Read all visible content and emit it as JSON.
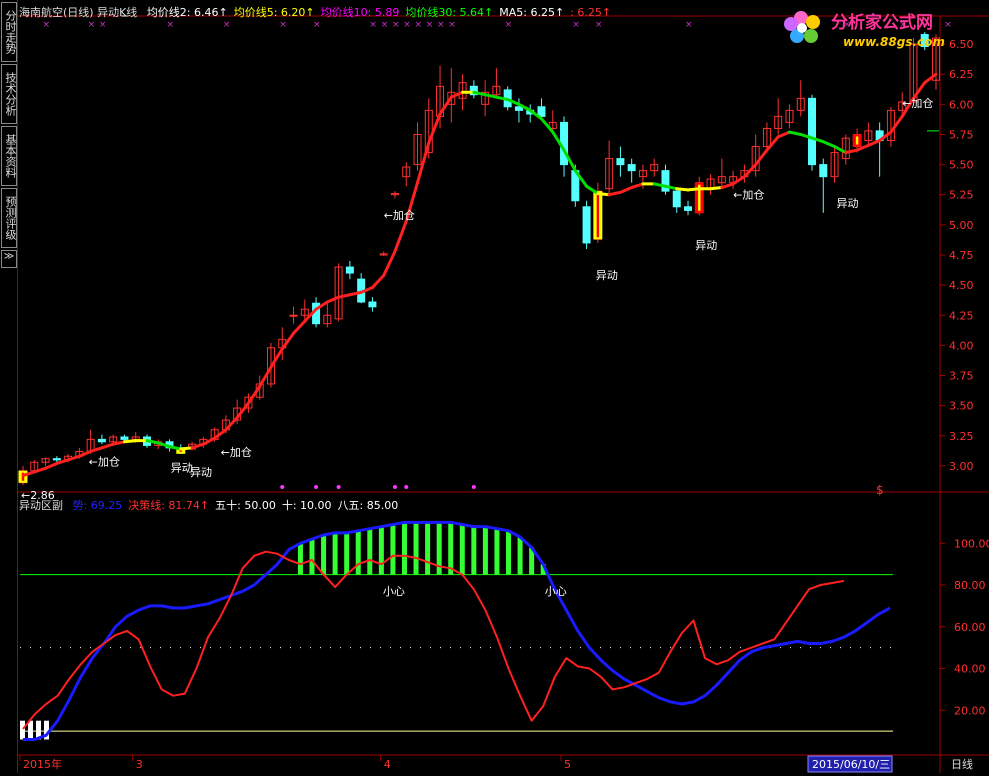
{
  "sidebar": {
    "tabs": [
      "分时走势",
      "技术分析",
      "基本资料",
      "预测评级"
    ],
    "more": "≫"
  },
  "main_header": {
    "stock": "海南航空(日线)",
    "indicator": "异动K线",
    "items": [
      {
        "label": "均价线2:",
        "value": "6.46",
        "color": "#ffffff",
        "arrow": "↑"
      },
      {
        "label": "均价线5:",
        "value": "6.20",
        "color": "#ffff00",
        "arrow": "↑"
      },
      {
        "label": "均价线10:",
        "value": "5.89",
        "color": "#ff00ff",
        "arrow": ""
      },
      {
        "label": "均价线30:",
        "value": "5.64",
        "color": "#00ff00",
        "arrow": "↑"
      },
      {
        "label": "MA5:",
        "value": "6.25",
        "color": "#ffffff",
        "arrow": "↑"
      },
      {
        "label": ":",
        "value": "6.25",
        "color": "#ff3030",
        "arrow": "↑"
      }
    ]
  },
  "sub_header": {
    "title": "异动区副",
    "items": [
      {
        "label": "势:",
        "value": "69.25",
        "color": "#2020ff"
      },
      {
        "label": "决策线:",
        "value": "81.74",
        "color": "#ff3030",
        "arrow": "↑"
      },
      {
        "label": "五十:",
        "value": "50.00",
        "color": "#ffffff"
      },
      {
        "label": "十:",
        "value": "10.00",
        "color": "#ffffff"
      },
      {
        "label": "八五:",
        "value": "85.00",
        "color": "#ffffff"
      }
    ]
  },
  "logo": {
    "text": "分析家公式网",
    "url": "www.88gs.com"
  },
  "x_axis": {
    "labels": [
      {
        "i": 0,
        "text": "2015年"
      },
      {
        "i": 10,
        "text": "3"
      },
      {
        "i": 32,
        "text": "4"
      },
      {
        "i": 48,
        "text": "5"
      }
    ],
    "current": "2015/06/10/三",
    "period": "日线"
  },
  "chart_data": [
    {
      "type": "candlestick",
      "title": "海南航空(日线)",
      "ylim": [
        2.8,
        6.7
      ],
      "y_ticks": [
        3.0,
        3.25,
        3.5,
        3.75,
        4.0,
        4.25,
        4.5,
        4.75,
        5.0,
        5.25,
        5.5,
        5.75,
        6.0,
        6.25,
        6.5
      ],
      "candles": [
        {
          "o": 2.86,
          "h": 3.0,
          "l": 2.84,
          "c": 2.96
        },
        {
          "o": 2.96,
          "h": 3.05,
          "l": 2.95,
          "c": 3.03
        },
        {
          "o": 3.03,
          "h": 3.07,
          "l": 3.0,
          "c": 3.06
        },
        {
          "o": 3.06,
          "h": 3.08,
          "l": 3.03,
          "c": 3.05
        },
        {
          "o": 3.05,
          "h": 3.1,
          "l": 3.03,
          "c": 3.08
        },
        {
          "o": 3.08,
          "h": 3.15,
          "l": 3.06,
          "c": 3.12
        },
        {
          "o": 3.12,
          "h": 3.3,
          "l": 3.1,
          "c": 3.22
        },
        {
          "o": 3.22,
          "h": 3.26,
          "l": 3.18,
          "c": 3.2
        },
        {
          "o": 3.2,
          "h": 3.26,
          "l": 3.18,
          "c": 3.24
        },
        {
          "o": 3.24,
          "h": 3.26,
          "l": 3.2,
          "c": 3.22
        },
        {
          "o": 3.22,
          "h": 3.28,
          "l": 3.19,
          "c": 3.24
        },
        {
          "o": 3.24,
          "h": 3.26,
          "l": 3.15,
          "c": 3.17
        },
        {
          "o": 3.17,
          "h": 3.22,
          "l": 3.14,
          "c": 3.2
        },
        {
          "o": 3.2,
          "h": 3.22,
          "l": 3.12,
          "c": 3.15
        },
        {
          "o": 3.15,
          "h": 3.18,
          "l": 3.1,
          "c": 3.14
        },
        {
          "o": 3.14,
          "h": 3.2,
          "l": 3.13,
          "c": 3.18
        },
        {
          "o": 3.18,
          "h": 3.24,
          "l": 3.15,
          "c": 3.22
        },
        {
          "o": 3.22,
          "h": 3.32,
          "l": 3.2,
          "c": 3.3
        },
        {
          "o": 3.3,
          "h": 3.42,
          "l": 3.27,
          "c": 3.38
        },
        {
          "o": 3.38,
          "h": 3.55,
          "l": 3.35,
          "c": 3.48
        },
        {
          "o": 3.48,
          "h": 3.6,
          "l": 3.44,
          "c": 3.57
        },
        {
          "o": 3.57,
          "h": 3.75,
          "l": 3.55,
          "c": 3.68
        },
        {
          "o": 3.68,
          "h": 4.02,
          "l": 3.65,
          "c": 3.98
        },
        {
          "o": 3.98,
          "h": 4.15,
          "l": 3.88,
          "c": 4.05
        },
        {
          "o": 4.25,
          "h": 4.32,
          "l": 4.18,
          "c": 4.25
        },
        {
          "o": 4.25,
          "h": 4.38,
          "l": 4.2,
          "c": 4.3
        },
        {
          "o": 4.35,
          "h": 4.4,
          "l": 4.15,
          "c": 4.18
        },
        {
          "o": 4.18,
          "h": 4.35,
          "l": 4.15,
          "c": 4.25
        },
        {
          "o": 4.22,
          "h": 4.68,
          "l": 4.2,
          "c": 4.65
        },
        {
          "o": 4.65,
          "h": 4.7,
          "l": 4.55,
          "c": 4.6
        },
        {
          "o": 4.55,
          "h": 4.6,
          "l": 4.35,
          "c": 4.36
        },
        {
          "o": 4.36,
          "h": 4.4,
          "l": 4.28,
          "c": 4.32
        },
        {
          "o": 4.75,
          "h": 4.78,
          "l": 4.74,
          "c": 4.76
        },
        {
          "o": 5.25,
          "h": 5.28,
          "l": 5.22,
          "c": 5.26
        },
        {
          "o": 5.4,
          "h": 5.52,
          "l": 5.32,
          "c": 5.48
        },
        {
          "o": 5.5,
          "h": 5.85,
          "l": 5.45,
          "c": 5.75
        },
        {
          "o": 5.6,
          "h": 6.05,
          "l": 5.55,
          "c": 5.95
        },
        {
          "o": 5.9,
          "h": 6.32,
          "l": 5.8,
          "c": 6.15
        },
        {
          "o": 6.0,
          "h": 6.3,
          "l": 5.85,
          "c": 6.1
        },
        {
          "o": 6.05,
          "h": 6.25,
          "l": 5.95,
          "c": 6.18
        },
        {
          "o": 6.15,
          "h": 6.2,
          "l": 6.05,
          "c": 6.08
        },
        {
          "o": 6.0,
          "h": 6.2,
          "l": 5.9,
          "c": 6.1
        },
        {
          "o": 6.08,
          "h": 6.3,
          "l": 6.05,
          "c": 6.15
        },
        {
          "o": 6.12,
          "h": 6.15,
          "l": 5.95,
          "c": 5.98
        },
        {
          "o": 5.98,
          "h": 6.05,
          "l": 5.85,
          "c": 5.95
        },
        {
          "o": 5.95,
          "h": 6.0,
          "l": 5.85,
          "c": 5.92
        },
        {
          "o": 5.98,
          "h": 6.05,
          "l": 5.88,
          "c": 5.9
        },
        {
          "o": 5.8,
          "h": 5.95,
          "l": 5.75,
          "c": 5.85
        },
        {
          "o": 5.85,
          "h": 5.9,
          "l": 5.4,
          "c": 5.5
        },
        {
          "o": 5.45,
          "h": 5.5,
          "l": 5.15,
          "c": 5.2
        },
        {
          "o": 5.15,
          "h": 5.2,
          "l": 4.8,
          "c": 4.85
        },
        {
          "o": 4.88,
          "h": 5.35,
          "l": 4.85,
          "c": 5.28
        },
        {
          "o": 5.3,
          "h": 5.7,
          "l": 5.25,
          "c": 5.55
        },
        {
          "o": 5.55,
          "h": 5.65,
          "l": 5.4,
          "c": 5.5
        },
        {
          "o": 5.5,
          "h": 5.55,
          "l": 5.35,
          "c": 5.45
        },
        {
          "o": 5.4,
          "h": 5.5,
          "l": 5.3,
          "c": 5.45
        },
        {
          "o": 5.45,
          "h": 5.55,
          "l": 5.4,
          "c": 5.5
        },
        {
          "o": 5.45,
          "h": 5.5,
          "l": 5.25,
          "c": 5.28
        },
        {
          "o": 5.28,
          "h": 5.3,
          "l": 5.1,
          "c": 5.15
        },
        {
          "o": 5.15,
          "h": 5.2,
          "l": 5.08,
          "c": 5.12
        },
        {
          "o": 5.1,
          "h": 5.4,
          "l": 5.08,
          "c": 5.35
        },
        {
          "o": 5.3,
          "h": 5.42,
          "l": 5.25,
          "c": 5.38
        },
        {
          "o": 5.35,
          "h": 5.55,
          "l": 5.3,
          "c": 5.4
        },
        {
          "o": 5.35,
          "h": 5.45,
          "l": 5.3,
          "c": 5.4
        },
        {
          "o": 5.4,
          "h": 5.5,
          "l": 5.35,
          "c": 5.45
        },
        {
          "o": 5.45,
          "h": 5.75,
          "l": 5.4,
          "c": 5.65
        },
        {
          "o": 5.65,
          "h": 5.85,
          "l": 5.6,
          "c": 5.8
        },
        {
          "o": 5.8,
          "h": 6.05,
          "l": 5.75,
          "c": 5.9
        },
        {
          "o": 5.85,
          "h": 6.0,
          "l": 5.8,
          "c": 5.95
        },
        {
          "o": 5.95,
          "h": 6.2,
          "l": 5.9,
          "c": 6.05
        },
        {
          "o": 6.05,
          "h": 6.08,
          "l": 5.45,
          "c": 5.5
        },
        {
          "o": 5.5,
          "h": 5.55,
          "l": 5.1,
          "c": 5.4
        },
        {
          "o": 5.4,
          "h": 5.65,
          "l": 5.35,
          "c": 5.6
        },
        {
          "o": 5.55,
          "h": 5.75,
          "l": 5.5,
          "c": 5.72
        },
        {
          "o": 5.65,
          "h": 5.8,
          "l": 5.6,
          "c": 5.75
        },
        {
          "o": 5.7,
          "h": 5.85,
          "l": 5.65,
          "c": 5.78
        },
        {
          "o": 5.78,
          "h": 5.85,
          "l": 5.4,
          "c": 5.7
        },
        {
          "o": 5.7,
          "h": 5.98,
          "l": 5.65,
          "c": 5.95
        },
        {
          "o": 5.95,
          "h": 6.1,
          "l": 5.88,
          "c": 6.02
        },
        {
          "o": 6.02,
          "h": 6.55,
          "l": 6.0,
          "c": 6.5
        },
        {
          "o": 6.58,
          "h": 6.6,
          "l": 6.45,
          "c": 6.48
        },
        {
          "o": 6.2,
          "h": 6.58,
          "l": 6.12,
          "c": 6.55
        }
      ],
      "highlights": [
        {
          "i": 0,
          "type": "rising"
        },
        {
          "i": 14,
          "type": "rising"
        },
        {
          "i": 51,
          "type": "rising"
        },
        {
          "i": 60,
          "type": "falling"
        },
        {
          "i": 74,
          "type": "falling"
        }
      ],
      "ma_line": [
        2.92,
        2.95,
        2.98,
        3.02,
        3.05,
        3.08,
        3.12,
        3.15,
        3.18,
        3.2,
        3.21,
        3.21,
        3.19,
        3.16,
        3.14,
        3.15,
        3.18,
        3.23,
        3.3,
        3.4,
        3.52,
        3.66,
        3.82,
        3.97,
        4.1,
        4.2,
        4.3,
        4.36,
        4.4,
        4.42,
        4.44,
        4.48,
        4.58,
        4.78,
        5.03,
        5.35,
        5.68,
        5.92,
        6.06,
        6.1,
        6.1,
        6.08,
        6.06,
        6.04,
        6.0,
        5.95,
        5.88,
        5.77,
        5.62,
        5.45,
        5.32,
        5.26,
        5.25,
        5.27,
        5.31,
        5.34,
        5.34,
        5.32,
        5.3,
        5.29,
        5.3,
        5.3,
        5.31,
        5.34,
        5.4,
        5.5,
        5.62,
        5.73,
        5.77,
        5.75,
        5.72,
        5.69,
        5.65,
        5.6,
        5.62,
        5.66,
        5.7,
        5.77,
        5.9,
        6.05,
        6.18,
        6.25
      ],
      "annotations": [
        {
          "i": 0,
          "y": 2.86,
          "text": "←2.86",
          "color": "#ffffff",
          "dy": 16,
          "dx": -2
        },
        {
          "i": 6,
          "y": 3.12,
          "text": "←加仓",
          "color": "#ffffff",
          "dy": 14,
          "dx": -2
        },
        {
          "i": 14,
          "y": 3.12,
          "text": "异动",
          "color": "#ffffff",
          "dy": 20,
          "dx": -10
        },
        {
          "i": 15,
          "y": 3.1,
          "text": "异动",
          "color": "#ffffff",
          "dy": 22,
          "dx": -2
        },
        {
          "i": 17,
          "y": 3.2,
          "text": "←加仓",
          "color": "#ffffff",
          "dy": 14,
          "dx": 6
        },
        {
          "i": 32,
          "y": 5.05,
          "text": "←加仓",
          "color": "#ffffff",
          "dy": 0,
          "dx": 0
        },
        {
          "i": 51,
          "y": 4.55,
          "text": "异动",
          "color": "#ffffff",
          "dy": 0,
          "dx": -2
        },
        {
          "i": 60,
          "y": 4.8,
          "text": "异动",
          "color": "#ffffff",
          "dy": 0,
          "dx": -4
        },
        {
          "i": 63,
          "y": 5.22,
          "text": "←加仓",
          "color": "#ffffff",
          "dy": 0,
          "dx": 0
        },
        {
          "i": 72,
          "y": 5.15,
          "text": "异动",
          "color": "#ffffff",
          "dy": 0,
          "dx": 2
        },
        {
          "i": 78,
          "y": 5.98,
          "text": "←加仓",
          "color": "#ffffff",
          "dy": 0,
          "dx": 0
        }
      ],
      "signal_marks": {
        "top_white": [
          9
        ],
        "top_magenta": [
          2,
          6,
          7,
          13,
          18,
          23,
          26,
          31,
          32,
          33,
          34,
          35,
          36,
          37,
          38,
          43,
          49,
          51,
          59,
          73,
          78,
          82
        ],
        "bottom_magenta": [
          23,
          26,
          28,
          33,
          34,
          40
        ]
      }
    },
    {
      "type": "line",
      "title": "异动区副",
      "ylim": [
        0,
        115
      ],
      "y_ticks": [
        20.0,
        40.0,
        60.0,
        80.0,
        100.0
      ],
      "series": [
        {
          "name": "势",
          "color": "#1a1aff",
          "values": [
            6,
            6,
            8,
            15,
            25,
            36,
            45,
            52,
            60,
            65,
            68,
            70,
            70,
            69,
            69,
            70,
            71,
            73,
            75,
            77,
            80,
            85,
            90,
            97,
            100,
            102,
            104,
            105,
            105,
            106,
            107,
            108,
            109,
            110,
            110,
            110,
            110,
            110,
            109,
            108,
            108,
            107,
            106,
            103,
            98,
            90,
            78,
            68,
            58,
            50,
            44,
            39,
            35,
            32,
            29,
            26,
            24,
            23,
            24,
            27,
            32,
            38,
            44,
            48,
            50,
            51,
            52,
            53,
            52,
            52,
            53,
            55,
            58,
            62,
            66,
            69
          ]
        },
        {
          "name": "决策线",
          "color": "#ff2020",
          "values": [
            11,
            18,
            23,
            27,
            35,
            42,
            48,
            52,
            56,
            58,
            54,
            41,
            30,
            27,
            28,
            40,
            55,
            64,
            75,
            88,
            94,
            96,
            95,
            92,
            90,
            92,
            85,
            79,
            85,
            90,
            92,
            90,
            94,
            94,
            93,
            91,
            89,
            88,
            85,
            78,
            68,
            55,
            40,
            27,
            15,
            22,
            36,
            45,
            41,
            40,
            36,
            30,
            31,
            33,
            35,
            38,
            48,
            57,
            63,
            45,
            42,
            44,
            48,
            50,
            52,
            54,
            62,
            70,
            78,
            80,
            81,
            82
          ]
        }
      ],
      "levels": [
        {
          "name": "五十",
          "value": 50,
          "color": "#ffffff",
          "dotted": true
        },
        {
          "name": "十",
          "value": 10,
          "color": "#ffff99",
          "dotted": false
        },
        {
          "name": "八五",
          "value": 85,
          "color": "#00ff00",
          "dotted": false
        }
      ],
      "green_bars_range": [
        24,
        49
      ],
      "annotations": [
        {
          "i": 32,
          "y": 80,
          "text": "小心"
        },
        {
          "i": 46,
          "y": 80,
          "text": "小心"
        }
      ]
    }
  ]
}
